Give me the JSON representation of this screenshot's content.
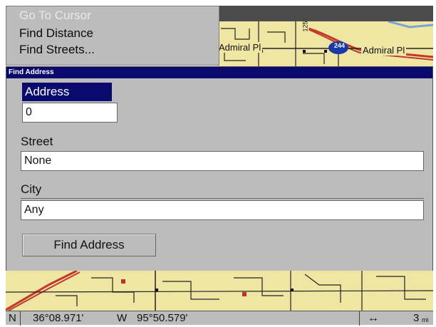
{
  "menu": {
    "items": [
      {
        "label": "Go To Cursor",
        "enabled": false
      },
      {
        "label": "Find Distance",
        "enabled": true
      },
      {
        "label": "Find Streets...",
        "enabled": true
      }
    ]
  },
  "map": {
    "labels": {
      "street_1": "Admiral Pl",
      "street_2": "Admiral Pl",
      "route_shield": "244",
      "road_number": "125"
    }
  },
  "dialog": {
    "title": "Find Address",
    "address": {
      "label": "Address",
      "value": "0"
    },
    "street": {
      "label": "Street",
      "value": "None"
    },
    "city": {
      "label": "City",
      "value": "Any"
    },
    "button_label": "Find Address"
  },
  "status": {
    "lat_hemisphere": "N",
    "latitude": "36°08.971'",
    "lon_hemisphere": "W",
    "longitude": "95°50.579'",
    "scale_icon": "horizontal-arrow-icon",
    "scale_value": "3",
    "scale_unit": "mi"
  },
  "colors": {
    "map": "#efe6a3",
    "dialog": "#bcbcbc",
    "title_bar": "#0a0a6e",
    "highway": "#c0392b"
  }
}
